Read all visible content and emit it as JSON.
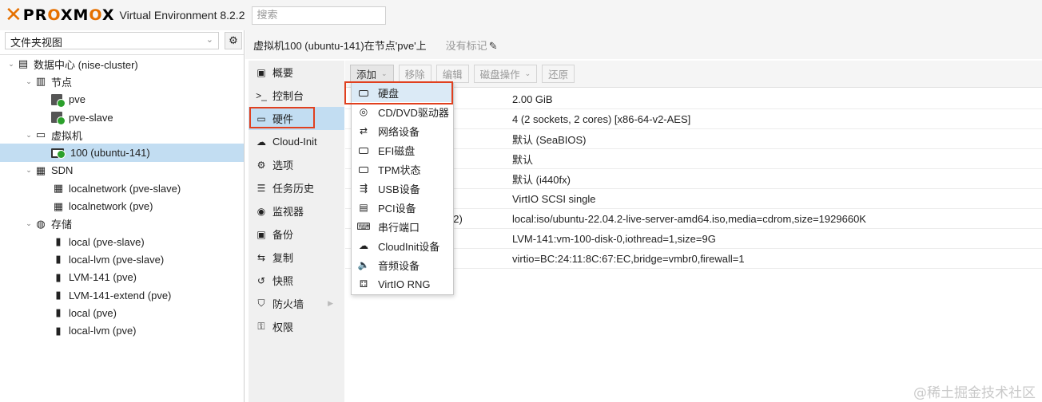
{
  "header": {
    "logo_x": "✕",
    "logo_text": "PROXMOX",
    "product": "Virtual Environment 8.2.2",
    "search_placeholder": "搜索"
  },
  "left": {
    "view_selector": "文件夹视图",
    "tree": [
      {
        "label": "数据中心 (nise-cluster)",
        "icon": "datacenter-icon",
        "depth": 0,
        "toggle": "⌄"
      },
      {
        "label": "节点",
        "icon": "building-icon",
        "depth": 1,
        "toggle": "⌄"
      },
      {
        "label": "pve",
        "icon": "server-online-icon",
        "depth": 2,
        "toggle": ""
      },
      {
        "label": "pve-slave",
        "icon": "server-online-icon",
        "depth": 2,
        "toggle": ""
      },
      {
        "label": "虚拟机",
        "icon": "desktop-icon",
        "depth": 1,
        "toggle": "⌄"
      },
      {
        "label": "100 (ubuntu-141)",
        "icon": "vm-running-icon",
        "depth": 2,
        "toggle": "",
        "selected": true
      },
      {
        "label": "SDN",
        "icon": "grid-icon",
        "depth": 1,
        "toggle": "⌄"
      },
      {
        "label": "localnetwork (pve-slave)",
        "icon": "grid-icon",
        "depth": 2,
        "toggle": ""
      },
      {
        "label": "localnetwork (pve)",
        "icon": "grid-icon",
        "depth": 2,
        "toggle": ""
      },
      {
        "label": "存储",
        "icon": "database-icon",
        "depth": 1,
        "toggle": "⌄"
      },
      {
        "label": "local (pve-slave)",
        "icon": "storage-icon",
        "depth": 2,
        "toggle": ""
      },
      {
        "label": "local-lvm (pve-slave)",
        "icon": "storage-icon",
        "depth": 2,
        "toggle": ""
      },
      {
        "label": "LVM-141 (pve)",
        "icon": "storage-icon",
        "depth": 2,
        "toggle": ""
      },
      {
        "label": "LVM-141-extend (pve)",
        "icon": "storage-icon",
        "depth": 2,
        "toggle": ""
      },
      {
        "label": "local (pve)",
        "icon": "storage-icon",
        "depth": 2,
        "toggle": ""
      },
      {
        "label": "local-lvm (pve)",
        "icon": "storage-icon",
        "depth": 2,
        "toggle": ""
      }
    ]
  },
  "vm_header": {
    "title": "虚拟机100 (ubuntu-141)在节点'pve'上",
    "tags": "没有标记"
  },
  "vmenu": [
    {
      "label": "概要",
      "icon": "book-icon"
    },
    {
      "label": "控制台",
      "icon": "terminal-icon"
    },
    {
      "label": "硬件",
      "icon": "monitor-icon",
      "active": true
    },
    {
      "label": "Cloud-Init",
      "icon": "cloud-icon"
    },
    {
      "label": "选项",
      "icon": "gear-icon"
    },
    {
      "label": "任务历史",
      "icon": "list-icon"
    },
    {
      "label": "监视器",
      "icon": "eye-icon"
    },
    {
      "label": "备份",
      "icon": "floppy-icon"
    },
    {
      "label": "复制",
      "icon": "retweet-icon"
    },
    {
      "label": "快照",
      "icon": "history-icon"
    },
    {
      "label": "防火墙",
      "icon": "shield-icon",
      "has_submenu": true
    },
    {
      "label": "权限",
      "icon": "unlock-icon"
    }
  ],
  "toolbar": {
    "add": "添加",
    "remove": "移除",
    "edit": "编辑",
    "disk_action": "磁盘操作",
    "revert": "还原"
  },
  "hardware_rows": [
    {
      "key": "",
      "value": "2.00 GiB"
    },
    {
      "key": "",
      "value": "4 (2 sockets, 2 cores) [x86-64-v2-AES]"
    },
    {
      "key": "",
      "value": "默认 (SeaBIOS)"
    },
    {
      "key": "",
      "value": "默认"
    },
    {
      "key": "",
      "value": "默认 (i440fx)"
    },
    {
      "key": "",
      "value": "VirtIO SCSI single"
    },
    {
      "key": "e2)",
      "value": "local:iso/ubuntu-22.04.2-live-server-amd64.iso,media=cdrom,size=1929660K"
    },
    {
      "key": "",
      "value": "LVM-141:vm-100-disk-0,iothread=1,size=9G"
    },
    {
      "key": "",
      "value": "virtio=BC:24:11:8C:67:EC,bridge=vmbr0,firewall=1"
    }
  ],
  "add_menu": [
    {
      "label": "硬盘",
      "icon": "hdd-icon",
      "highlighted": true
    },
    {
      "label": "CD/DVD驱动器",
      "icon": "disc-icon"
    },
    {
      "label": "网络设备",
      "icon": "exchange-icon"
    },
    {
      "label": "EFI磁盘",
      "icon": "hdd-icon"
    },
    {
      "label": "TPM状态",
      "icon": "hdd-icon"
    },
    {
      "label": "USB设备",
      "icon": "usb-icon"
    },
    {
      "label": "PCI设备",
      "icon": "pci-card-icon"
    },
    {
      "label": "串行端口",
      "icon": "keyboard-icon"
    },
    {
      "label": "CloudInit设备",
      "icon": "cloud-icon"
    },
    {
      "label": "音频设备",
      "icon": "volume-icon"
    },
    {
      "label": "VirtIO RNG",
      "icon": "dice-icon"
    }
  ],
  "watermark": "@稀土掘金技术社区",
  "colors": {
    "accent": "#e57000",
    "selection": "#c2ddf2",
    "highlight_box": "#e0401f",
    "status_ok": "#2ca02c"
  }
}
